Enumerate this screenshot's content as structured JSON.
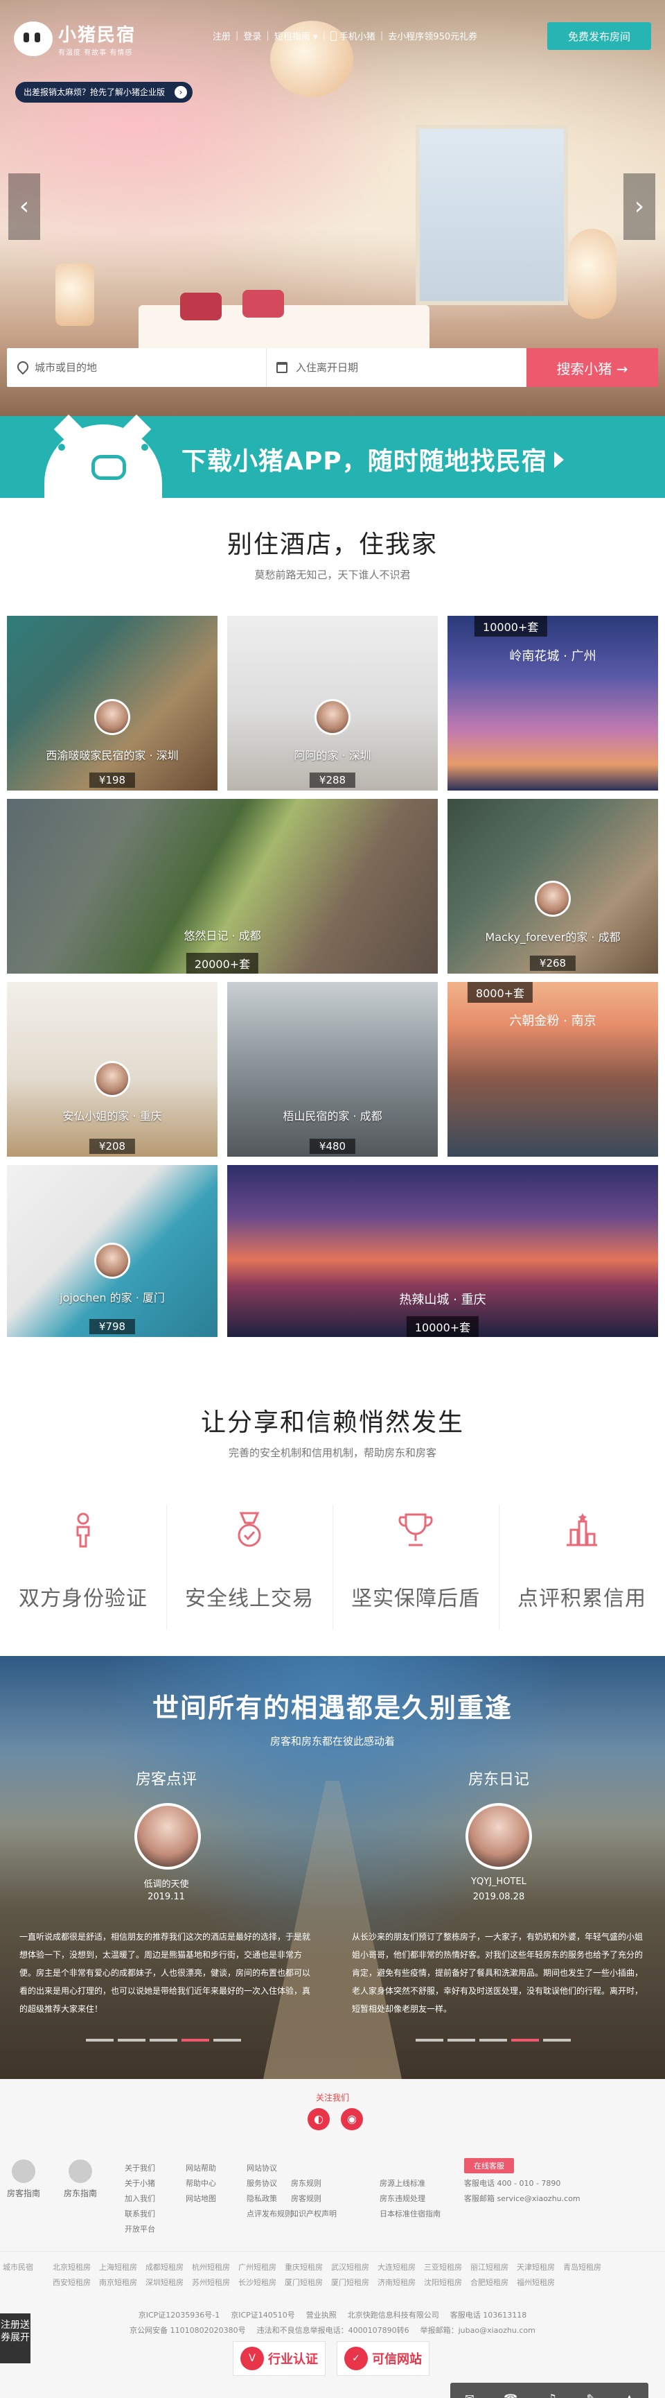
{
  "brand": {
    "name": "小猪民宿",
    "slogan": "有温度 有故事 有情感"
  },
  "nav": {
    "register": "注册",
    "login": "登录",
    "landlord_guide": "短租指南",
    "mobile_app": "手机小猪",
    "mini_program": "去小程序领950元礼券"
  },
  "publish_button": "免费发布房间",
  "enterprise_banner": "出差报销太麻烦？抢先了解小猪企业版",
  "search": {
    "city_placeholder": "城市或目的地",
    "date_placeholder": "入住离开日期",
    "button": "搜索小猪"
  },
  "app_banner": {
    "text": "下载小猪APP，随时随地找民宿"
  },
  "section_stay": {
    "title": "别住酒店，住我家",
    "subtitle": "莫愁前路无知己，天下谁人不识君"
  },
  "grid": {
    "t1": {
      "host": "西渝啵啵家民宿的家 · 深圳",
      "price": "¥198"
    },
    "t2": {
      "host": "阿阿的家 · 深圳",
      "price": "¥288"
    },
    "t3": {
      "count": "10000+套",
      "city": "岭南花城 · 广州"
    },
    "t4": {
      "host": "悠然日记 · 成都",
      "count": "20000+套"
    },
    "t5": {
      "host": "Macky_forever的家 · 成都",
      "price": "¥268"
    },
    "t6": {
      "host": "安仏小姐的家 · 重庆",
      "price": "¥208"
    },
    "t7": {
      "host": "梧山民宿的家 · 成都",
      "price": "¥480"
    },
    "t8": {
      "count": "8000+套",
      "city": "六朝金粉 · 南京"
    },
    "t9": {
      "host": "jojochen 的家 · 厦门",
      "price": "¥798"
    },
    "t10": {
      "city": "热辣山城 · 重庆",
      "count": "10000+套"
    }
  },
  "section_trust": {
    "title": "让分享和信赖悄然发生",
    "subtitle": "完善的安全机制和信用机制，帮助房东和房客",
    "items": [
      "双方身份验证",
      "安全线上交易",
      "坚实保障后盾",
      "点评积累信用"
    ]
  },
  "section_story": {
    "title": "世间所有的相遇都是久别重逢",
    "subtitle": "房客和房东都在彼此感动着",
    "guest": {
      "col_title": "房客点评",
      "name": "低调的天使",
      "date": "2019.11",
      "text": "一直听说成都很是舒适，相信朋友的推荐我们这次的酒店是最好的选择，于是就想体验一下，没想到，太温暖了。周边是熊猫基地和步行街，交通也是非常方便。房主是个非常有爱心的成都妹子，人也很漂亮，健谈，房间的布置也都可以看的出来是用心打理的，也可以说她是带给我们近年来最好的一次入住体验，真的超级推荐大家来住！"
    },
    "host": {
      "col_title": "房东日记",
      "name": "YQYJ_HOTEL",
      "date": "2019.08.28",
      "text": "从长沙来的朋友们预订了整栋房子，一大家子，有奶奶和外婆，年轻气盛的小姐姐小哥哥，他们都非常的热情好客。对我们这些年轻房东的服务也给予了充分的肯定，避免有些疫情，提前备好了餐具和洗漱用品。期间也发生了一些小插曲，老人家身体突然不舒服，幸好有及时送医处理，没有耽误他们的行程。离开时，短暂相处却像老朋友一样。"
    }
  },
  "footer": {
    "follow": "关注我们",
    "guides": [
      "房客指南",
      "房东指南"
    ],
    "links_col1": [
      "关于我们",
      "关于小猪",
      "加入我们",
      "联系我们",
      "开放平台"
    ],
    "links_col2": [
      "网站帮助",
      "帮助中心",
      "网站地图"
    ],
    "links_col3": [
      "网站协议",
      "服务协议",
      "隐私政策",
      "点评发布规则"
    ],
    "links_col4": [
      "房东规则",
      "房客规则",
      "知识产权声明"
    ],
    "links_col5": [
      "房源上线标准",
      "房东违规处理",
      "日本标准住宿指南"
    ],
    "online_service": "在线客服",
    "hotline": "客服电话 400 - 010 - 7890",
    "email": "客服邮箱 service@xiaozhu.com",
    "city_label": "城市民宿",
    "cities": [
      "北京短租房",
      "上海短租房",
      "成都短租房",
      "杭州短租房",
      "广州短租房",
      "重庆短租房",
      "武汉短租房",
      "大连短租房",
      "三亚短租房",
      "丽江短租房",
      "天津短租房",
      "青岛短租房",
      "西安短租房",
      "南京短租房",
      "深圳短租房",
      "苏州短租房",
      "长沙短租房",
      "厦门短租房",
      "厦门短租房",
      "济南短租房",
      "沈阳短租房",
      "合肥短租房",
      "福州短租房"
    ],
    "copyright_line1": [
      "京ICP证12035936号-1",
      "京ICP证140510号",
      "营业执照",
      "北京快跑信息科技有限公司",
      "客服电话 103613118"
    ],
    "copyright_line2": [
      "京公网安备 11010802020380号",
      "违法和不良信息举报电话：4000107890转6",
      "举报邮箱：jubao@xiaozhu.com"
    ],
    "cert_industry": "行业认证",
    "cert_trusted": "可信网站",
    "register_tab": "注册送券展开",
    "toolbar_icons": [
      "chat",
      "phone",
      "bell",
      "edit",
      "top"
    ]
  }
}
